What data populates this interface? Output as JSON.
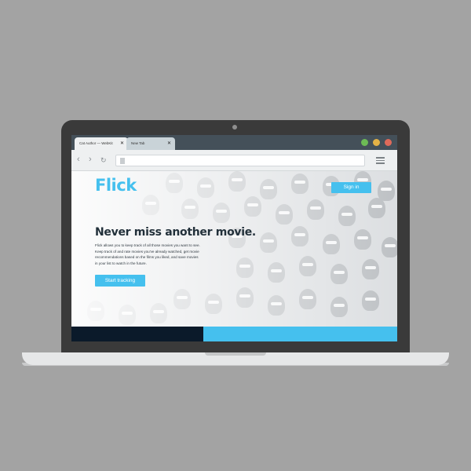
{
  "browser": {
    "tabs": [
      {
        "label": "Cat Author — WebKit",
        "close": "✕"
      },
      {
        "label": "New Tab",
        "close": "✕"
      }
    ],
    "window_controls": {
      "green": "#6dbb55",
      "yellow": "#e4b246",
      "red": "#df6a5a"
    },
    "nav": {
      "back": "‹",
      "forward": "›",
      "reload": "↻"
    },
    "url": ""
  },
  "page": {
    "logo": "Flick",
    "signin_label": "Sign in",
    "headline": "Never miss another movie.",
    "description": [
      "Flick allows you to keep track of all those movies you want to see.",
      "Keep track of and rate movies you've already watched, get movie",
      "recommendations based on the films you liked, and save movies",
      "in your list to watch in the future."
    ],
    "cta_label": "Start tracking",
    "colors": {
      "accent": "#45c0ee",
      "text": "#22303a",
      "footer_dark": "#0b1a2a"
    }
  }
}
